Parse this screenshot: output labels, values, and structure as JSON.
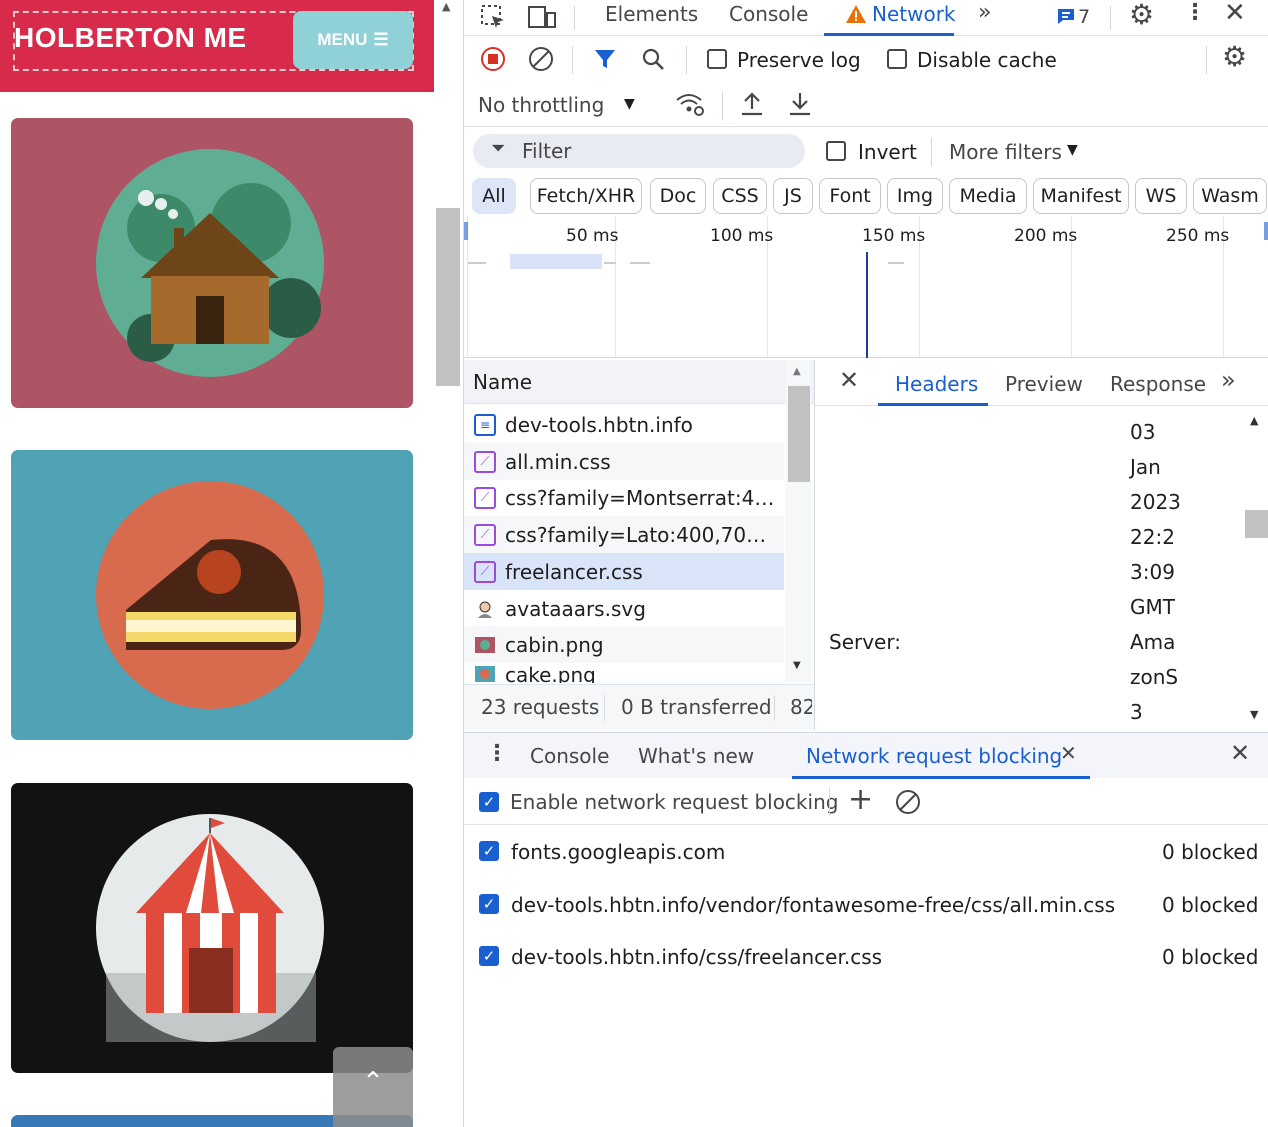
{
  "site": {
    "brand": "HOLBERTON ME",
    "menu_label": "MENU",
    "colors": {
      "nav": "#d82a4a",
      "cabin_card": "#ae5565",
      "cake_card": "#4fa3b5",
      "circus_card": "#121212",
      "next_card": "#3779b6"
    },
    "scroll_top_glyph": "⌃"
  },
  "devtools": {
    "tabs": {
      "elements": "Elements",
      "console": "Console",
      "network": "Network",
      "issues_count": "7"
    },
    "toolbar": {
      "preserve_log": "Preserve log",
      "disable_cache": "Disable cache",
      "throttling": "No throttling"
    },
    "filter": {
      "placeholder": "Filter",
      "invert": "Invert",
      "more_filters": "More filters"
    },
    "type_filters": [
      "All",
      "Fetch/XHR",
      "Doc",
      "CSS",
      "JS",
      "Font",
      "Img",
      "Media",
      "Manifest",
      "WS",
      "Wasm"
    ],
    "timeline_ticks": [
      "50 ms",
      "100 ms",
      "150 ms",
      "200 ms",
      "250 ms"
    ],
    "requests": {
      "header": "Name",
      "rows": [
        {
          "name": "dev-tools.hbtn.info",
          "type": "doc"
        },
        {
          "name": "all.min.css",
          "type": "css"
        },
        {
          "name": "css?family=Montserrat:400,...",
          "type": "css"
        },
        {
          "name": "css?family=Lato:400,700,40...",
          "type": "css"
        },
        {
          "name": "freelancer.css",
          "type": "css"
        },
        {
          "name": "avataaars.svg",
          "type": "img"
        },
        {
          "name": "cabin.png",
          "type": "img"
        },
        {
          "name": "cake.png",
          "type": "img"
        }
      ]
    },
    "status": {
      "requests": "23 requests",
      "transferred": "0 B transferred",
      "resources": "82"
    },
    "detail": {
      "tabs": [
        "Headers",
        "Preview",
        "Response"
      ],
      "values": [
        "03",
        "Jan",
        "2023",
        "22:2",
        "3:09",
        "GMT"
      ],
      "server_label": "Server:",
      "server_values": [
        "Ama",
        "zonS",
        "3"
      ]
    },
    "drawer": {
      "tabs": {
        "console": "Console",
        "whats_new": "What's new",
        "blocking": "Network request blocking"
      },
      "enable_label": "Enable network request blocking",
      "patterns": [
        {
          "url": "fonts.googleapis.com",
          "count": "0 blocked"
        },
        {
          "url": "dev-tools.hbtn.info/vendor/fontawesome-free/css/all.min.css",
          "count": "0 blocked"
        },
        {
          "url": "dev-tools.hbtn.info/css/freelancer.css",
          "count": "0 blocked"
        }
      ]
    }
  }
}
